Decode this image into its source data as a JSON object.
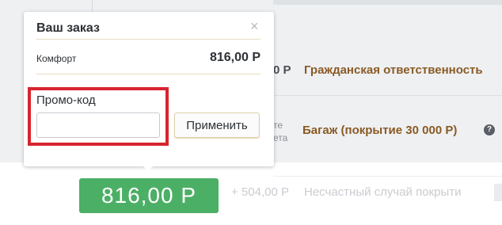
{
  "background": {
    "rows": [
      {
        "price": "0 Р",
        "link": "Гражданская ответственность"
      },
      {
        "side_text_1": "те",
        "side_text_2": "ета",
        "link": "Багаж (покрытие 30 000 Р)"
      },
      {
        "price": "+ 504,00 Р",
        "link": "Несчастный случай покрыти"
      }
    ]
  },
  "order_popup": {
    "title": "Ваш заказ",
    "close_icon": "close-icon",
    "item_name": "Комфорт",
    "item_price": "816,00 Р",
    "promo_label": "Промо-код",
    "promo_value": "",
    "apply_label": "Применить"
  },
  "total": {
    "label": "816,00 Р"
  },
  "colors": {
    "accent_green": "#4caf66",
    "link_brown": "#8a5a24",
    "highlight_red": "#d6252f"
  }
}
